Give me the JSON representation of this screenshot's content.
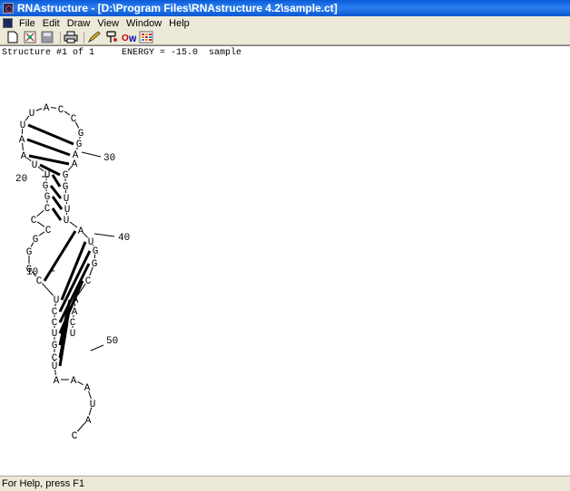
{
  "window": {
    "title": "RNAstructure - [D:\\Program Files\\RNAstructure 4.2\\sample.ct]"
  },
  "menu": [
    "File",
    "Edit",
    "Draw",
    "View",
    "Window",
    "Help"
  ],
  "toolbar": [
    {
      "name": "new-icon"
    },
    {
      "name": "open-icon"
    },
    {
      "name": "save-icon"
    },
    {
      "name": "print-icon"
    },
    {
      "name": "pencil-icon"
    },
    {
      "name": "fold-icon"
    },
    {
      "name": "oligo-icon"
    },
    {
      "name": "dotplot-icon"
    }
  ],
  "structure": {
    "header": "Structure #1 of 1     ENERGY = -15.0  sample",
    "nucleotides": [
      {
        "n": 1,
        "b": "C"
      },
      {
        "n": 2,
        "b": "A"
      },
      {
        "n": 3,
        "b": "U"
      },
      {
        "n": 4,
        "b": "A"
      },
      {
        "n": 5,
        "b": "A"
      },
      {
        "n": 6,
        "b": "A"
      },
      {
        "n": 7,
        "b": "U"
      },
      {
        "n": 8,
        "b": "C"
      },
      {
        "n": 9,
        "b": "G"
      },
      {
        "n": 10,
        "b": "U"
      },
      {
        "n": 11,
        "b": "C"
      },
      {
        "n": 12,
        "b": "C"
      },
      {
        "n": 13,
        "b": "U"
      },
      {
        "n": 14,
        "b": "C"
      },
      {
        "n": 15,
        "b": "G"
      },
      {
        "n": 16,
        "b": "G"
      },
      {
        "n": 17,
        "b": "G"
      },
      {
        "n": 18,
        "b": "C"
      },
      {
        "n": 19,
        "b": "C"
      },
      {
        "n": 20,
        "b": "C"
      },
      {
        "n": 21,
        "b": "G"
      },
      {
        "n": 22,
        "b": "G"
      },
      {
        "n": 23,
        "b": "U"
      },
      {
        "n": 24,
        "b": "U"
      },
      {
        "n": 25,
        "b": "A"
      },
      {
        "n": 26,
        "b": "A"
      },
      {
        "n": 27,
        "b": "U"
      },
      {
        "n": 28,
        "b": "U"
      },
      {
        "n": 29,
        "b": "A"
      },
      {
        "n": 30,
        "b": "C"
      },
      {
        "n": 31,
        "b": "C"
      },
      {
        "n": 32,
        "b": "G"
      },
      {
        "n": 33,
        "b": "G"
      },
      {
        "n": 34,
        "b": "A"
      },
      {
        "n": 35,
        "b": "A"
      },
      {
        "n": 36,
        "b": "G"
      },
      {
        "n": 37,
        "b": "G"
      },
      {
        "n": 38,
        "b": "U"
      },
      {
        "n": 39,
        "b": "U"
      },
      {
        "n": 40,
        "b": "U"
      },
      {
        "n": 41,
        "b": "A"
      },
      {
        "n": 42,
        "b": "U"
      },
      {
        "n": 43,
        "b": "G"
      },
      {
        "n": 44,
        "b": "G"
      },
      {
        "n": 45,
        "b": "C"
      },
      {
        "n": 46,
        "b": "A"
      },
      {
        "n": 47,
        "b": "A"
      },
      {
        "n": 48,
        "b": "C"
      },
      {
        "n": 49,
        "b": "U"
      }
    ],
    "labels": [
      {
        "text": "10"
      },
      {
        "text": "20"
      },
      {
        "text": "30"
      },
      {
        "text": "40"
      },
      {
        "text": "50"
      }
    ]
  },
  "status": {
    "text": "For Help, press F1"
  }
}
